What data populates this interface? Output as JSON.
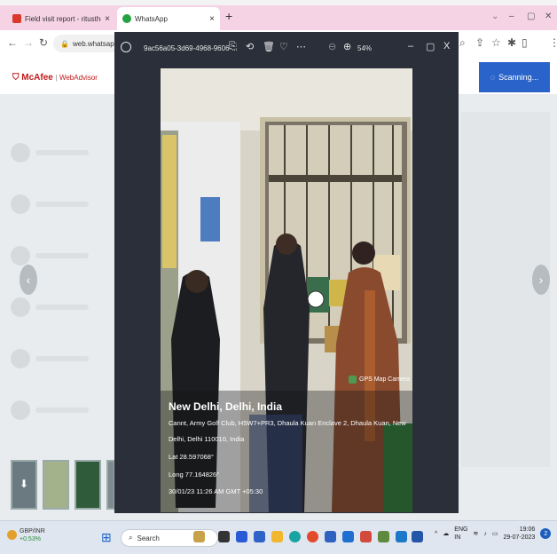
{
  "browser": {
    "tabs": [
      {
        "label": "Field visit report - ritusthey@...",
        "close": "×"
      },
      {
        "label": "WhatsApp",
        "close": "×"
      }
    ],
    "new_tab": "+",
    "url": "web.whatsapp.com",
    "window_controls": [
      "⌄",
      "–",
      "▢",
      "✕"
    ]
  },
  "extension": {
    "mcafee": "McAfee",
    "webadvisor": "WebAdvisor",
    "scanning": "Scanning..."
  },
  "viewer": {
    "file_name": "9ac56a05-3d69-4968-9606-...",
    "zoom": "54%",
    "window_controls": [
      "–",
      "▢",
      "X"
    ]
  },
  "photo": {
    "stamp": "GPS Map Camera",
    "place": "New Delhi, Delhi, India",
    "address_line1": "Cannt, Army Golf Club, H5W7+PR3, Dhaula Kuan Enclave 2, Dhaula Kuan, New",
    "address_line2": "Delhi, Delhi 110010, India",
    "lat": "Lat 28.597068°",
    "long": "Long 77.164826°",
    "datetime": "30/01/23 11:26 AM GMT +05:30"
  },
  "taskbar": {
    "ticker_name": "GBP/INR",
    "ticker_change": "+0.53%",
    "search": "Search",
    "lang": "ENG",
    "region": "IN",
    "time": "19:06",
    "date": "29-07-2023",
    "notif": "2"
  }
}
